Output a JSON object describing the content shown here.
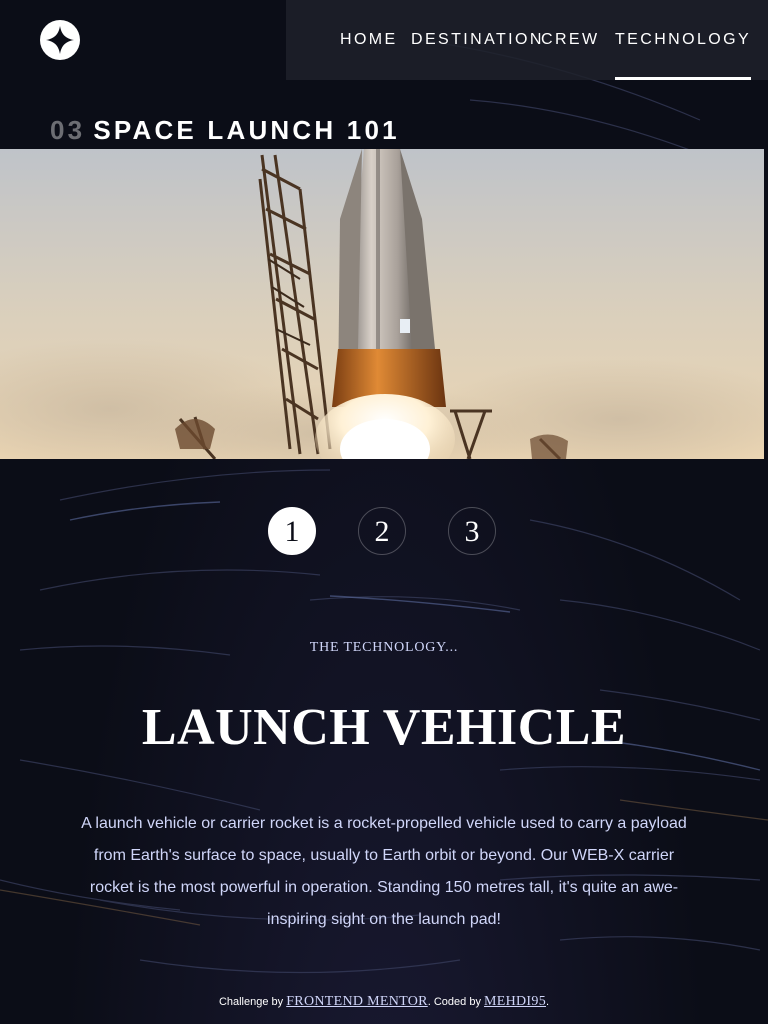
{
  "nav": {
    "items": [
      {
        "label": "HOME",
        "active": false
      },
      {
        "label": "DESTINATION",
        "active": false
      },
      {
        "label": "CREW",
        "active": false
      },
      {
        "label": "TECHNOLOGY",
        "active": true
      }
    ]
  },
  "heading": {
    "number": "03",
    "label": "SPACE LAUNCH 101"
  },
  "steps": [
    "1",
    "2",
    "3"
  ],
  "active_step": "1",
  "content": {
    "kicker": "THE TECHNOLOGY...",
    "title": "LAUNCH VEHICLE",
    "description": "A launch vehicle or carrier rocket is a rocket-propelled vehicle used to carry a payload from Earth's surface to space, usually to Earth orbit or beyond. Our WEB-X carrier rocket is the most powerful in operation. Standing 150 metres tall, it's quite an awe-inspiring sight on the launch pad!"
  },
  "footer": {
    "prefix": "Challenge by",
    "challenge_link": "FRONTEND MENTOR",
    "middle": ". Coded by",
    "author_link": "MEHDI95",
    "suffix": "."
  },
  "colors": {
    "background": "#0b0d17",
    "accent_light": "#d0d6f9",
    "white": "#ffffff"
  },
  "icons": {
    "logo": "four-point-star-logo-icon"
  }
}
